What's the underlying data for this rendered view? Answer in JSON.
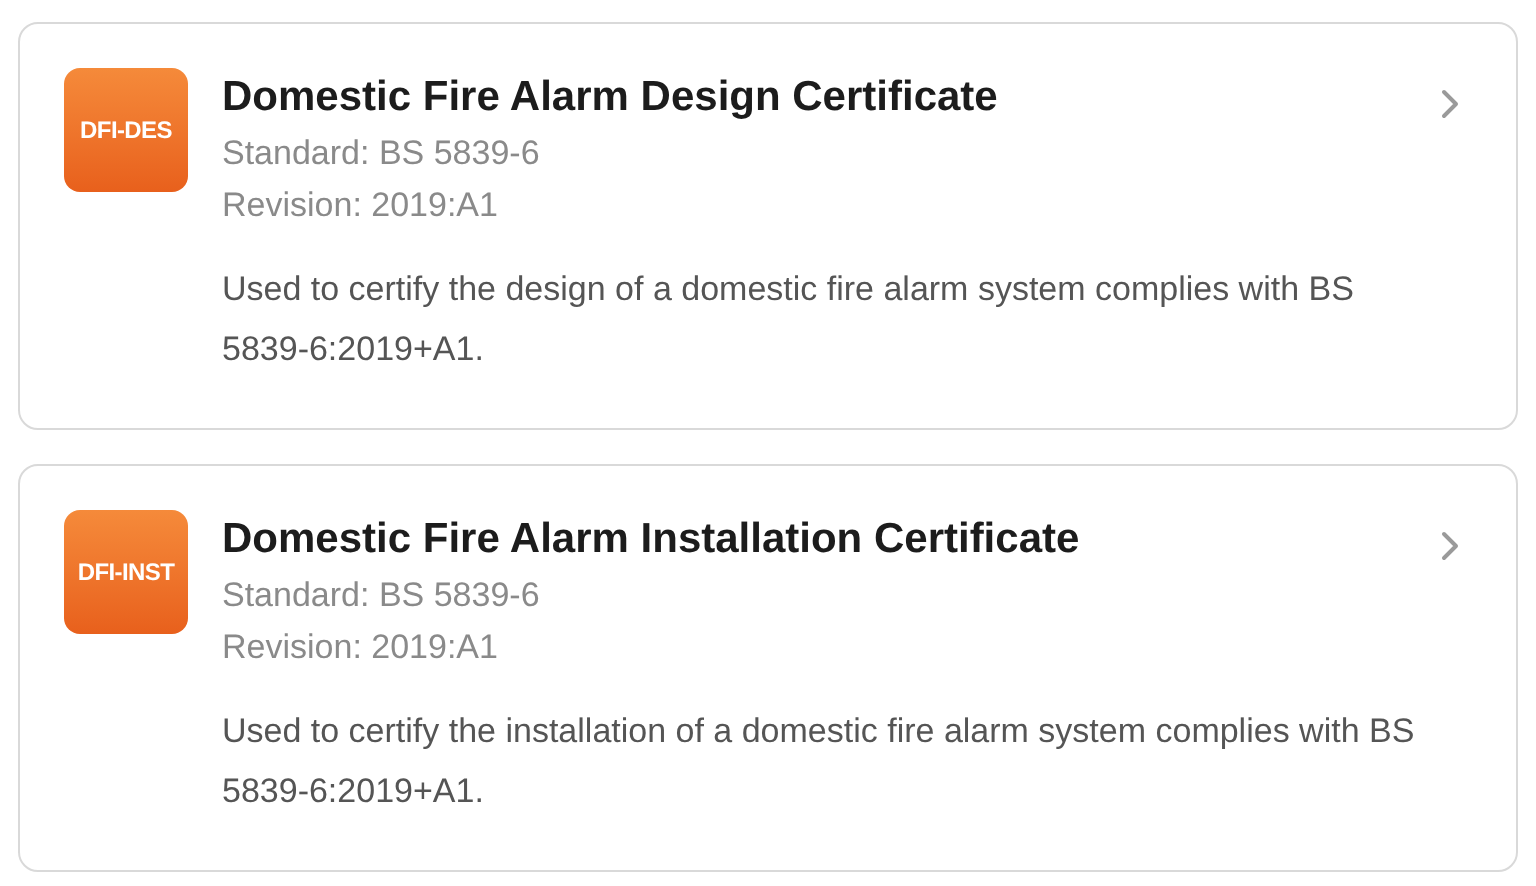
{
  "certificates": [
    {
      "badge": "DFI-DES",
      "title": "Domestic Fire Alarm Design Certificate",
      "standard": "Standard: BS 5839-6",
      "revision": "Revision: 2019:A1",
      "description": "Used to certify the design of a domestic fire alarm system complies with BS 5839-6:2019+A1."
    },
    {
      "badge": "DFI-INST",
      "title": "Domestic Fire Alarm Installation Certificate",
      "standard": "Standard: BS 5839-6",
      "revision": "Revision: 2019:A1",
      "description": "Used to certify the installation of a domestic fire alarm system complies with BS 5839-6:2019+A1."
    }
  ]
}
